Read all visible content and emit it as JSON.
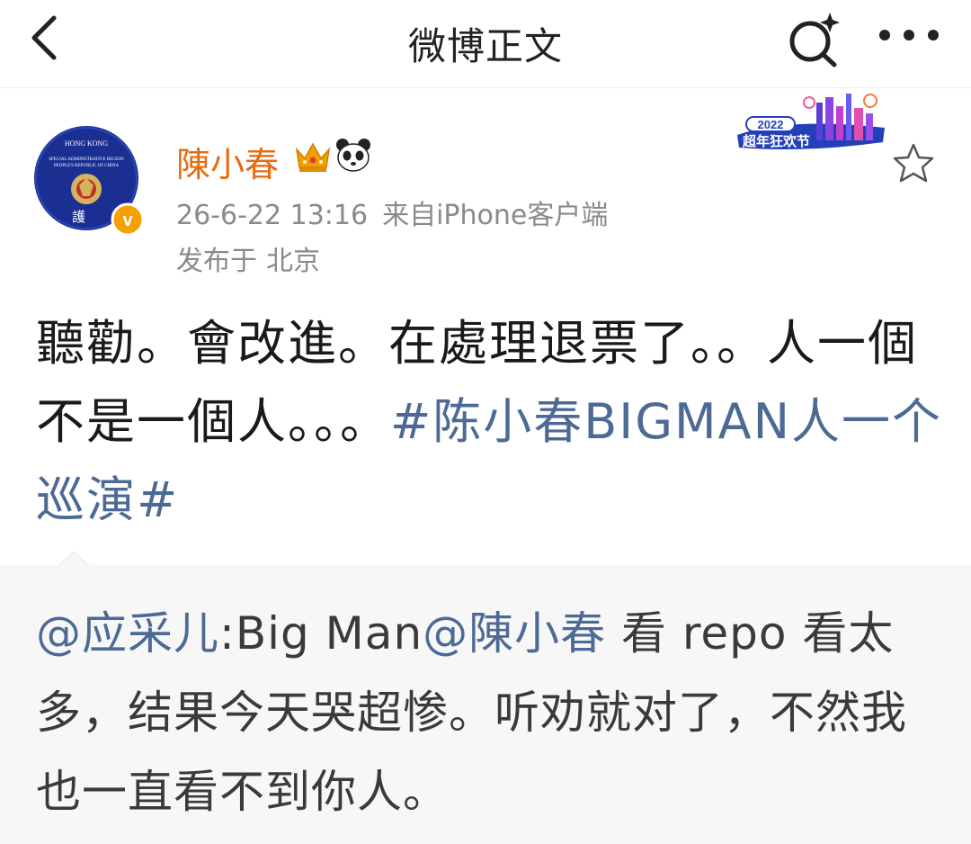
{
  "navbar": {
    "title": "微博正文",
    "back_icon": "chevron-left-icon",
    "search_icon": "search-sparkle-icon",
    "more_icon": "more-dots-icon"
  },
  "author": {
    "name": "陳小春",
    "avatar_icon": "avatar-emblem",
    "avatar_text": {
      "top": "HONG KONG",
      "line1": "SPECIAL ADMINISTRATIVE REGION",
      "line2": "PEOPLE'S REPUBLIC OF CHINA",
      "bottom": "護"
    },
    "verified_badge": "v",
    "crown_icon": "crown-icon",
    "panda_icon": "panda-icon"
  },
  "meta": {
    "datetime": "26-6-22 13:16",
    "source": "来自iPhone客户端",
    "location_label": "发布于",
    "location": "北京"
  },
  "event_badge": {
    "year": "2022",
    "label": "超年狂欢节"
  },
  "post": {
    "text": "聽勸。會改進。在處理退票了。。人一個不是一個人。。。",
    "hashtag": "#陈小春BIGMAN人一个巡演#"
  },
  "repost": {
    "mention1": "@应采儿",
    "text1": ":Big Man",
    "mention2": "@陳小春",
    "text2": " 看 repo 看太多，结果今天哭超惨。听劝就对了，不然我也一直看不到你人。"
  },
  "colors": {
    "author_name": "#e86b10",
    "link": "#4d6a95",
    "meta": "#8a8a8a",
    "repost_bg": "#f7f7f7"
  }
}
